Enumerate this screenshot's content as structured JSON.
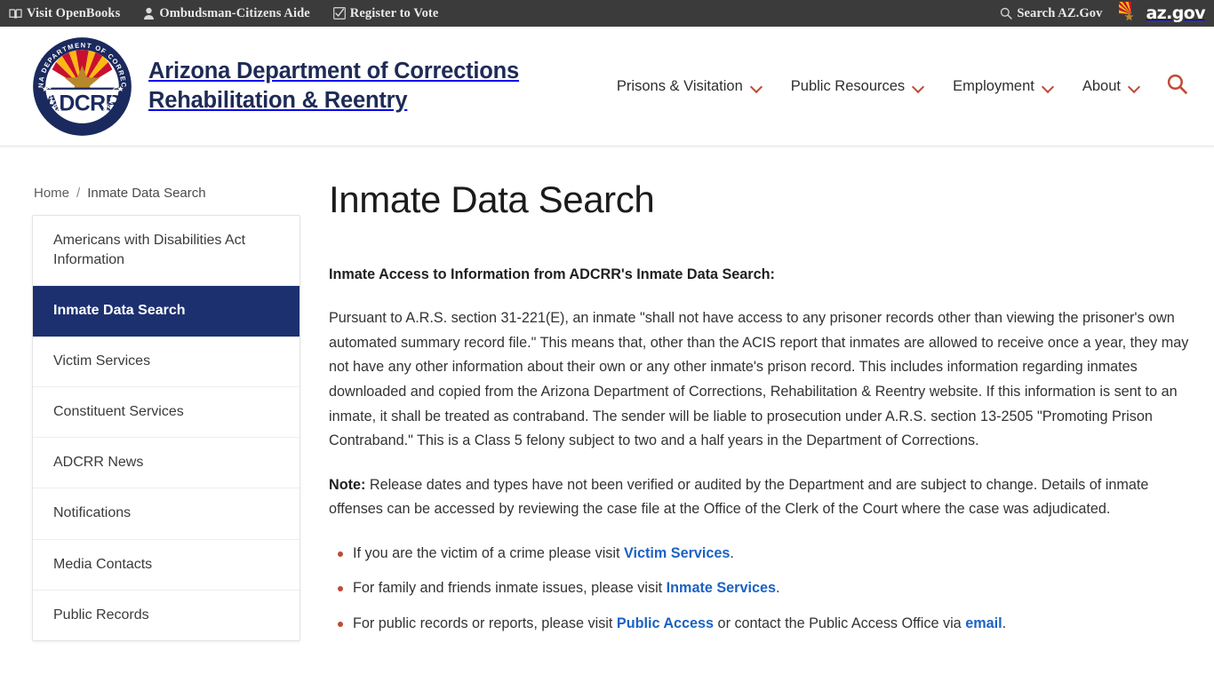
{
  "topbar": {
    "links": [
      {
        "label": "Visit OpenBooks",
        "icon": "book-icon"
      },
      {
        "label": "Ombudsman-Citizens Aide",
        "icon": "person-icon"
      },
      {
        "label": "Register to Vote",
        "icon": "checkbox-checked-icon"
      }
    ],
    "search_label": "Search AZ.Gov",
    "search_icon": "search-icon",
    "azgov_logo_text": "az.gov",
    "background": "#3b3b3b"
  },
  "header": {
    "seal": {
      "icon": "adcrr-seal-icon",
      "top_arc_text": "ARIZONA DEPARTMENT OF CORRECTIONS",
      "bottom_arc_text": "REHABILITATION & REENTRY",
      "center_text": "ADCRR"
    },
    "site_title_line1": "Arizona Department of Corrections",
    "site_title_line2": "Rehabilitation & Reentry",
    "title_color": "#1e2b56",
    "nav": [
      {
        "label": "Prisons & Visitation",
        "has_dropdown": true
      },
      {
        "label": "Public Resources",
        "has_dropdown": true
      },
      {
        "label": "Employment",
        "has_dropdown": true
      },
      {
        "label": "About",
        "has_dropdown": true
      }
    ],
    "search_icon": "search-icon",
    "accent_color": "#bf4b36"
  },
  "breadcrumb": {
    "home": "Home",
    "separator": "/",
    "current": "Inmate Data Search"
  },
  "sidebar": {
    "items": [
      {
        "label": "Americans with Disabilities Act Information",
        "active": false
      },
      {
        "label": "Inmate Data Search",
        "active": true
      },
      {
        "label": "Victim Services",
        "active": false
      },
      {
        "label": "Constituent Services",
        "active": false
      },
      {
        "label": "ADCRR News",
        "active": false
      },
      {
        "label": "Notifications",
        "active": false
      },
      {
        "label": "Media Contacts",
        "active": false
      },
      {
        "label": "Public Records",
        "active": false
      }
    ],
    "active_background": "#1c3070"
  },
  "main": {
    "page_title": "Inmate Data Search",
    "lead": "Inmate Access to Information from ADCRR's Inmate Data Search:",
    "paragraph1": "Pursuant to A.R.S. section 31-221(E), an inmate \"shall not have access to any prisoner records other than viewing the prisoner's own automated summary record file.\" This means that, other than the ACIS report that inmates are allowed to receive once a year, they may not have any other information about their own or any other inmate's prison record. This includes information regarding inmates downloaded and copied from the Arizona Department of Corrections, Rehabilitation & Reentry website. If this information is sent to an inmate, it shall be treated as contraband. The sender will be liable to prosecution under A.R.S. section 13-2505 \"Promoting Prison Contraband.\"  This is a Class 5 felony subject to two and a half years in the Department of Corrections.",
    "note_label": "Note:",
    "note_text": " Release dates and types have not been verified or audited by the Department and are subject to change. Details of inmate offenses can be accessed by reviewing the case file at the Office of the Clerk of the Court where the case was adjudicated.",
    "bullets": [
      {
        "before": "If you are the victim of a crime please visit ",
        "link": "Victim Services",
        "after": "."
      },
      {
        "before": "For family and friends inmate issues, please visit ",
        "link": "Inmate Services",
        "after": "."
      },
      {
        "before": "For public records or reports, please visit ",
        "link": "Public Access",
        "middle": " or contact the Public Access Office via ",
        "link2": "email",
        "after": "."
      }
    ],
    "link_color": "#1b62c4",
    "bullet_color": "#bf4b36"
  }
}
